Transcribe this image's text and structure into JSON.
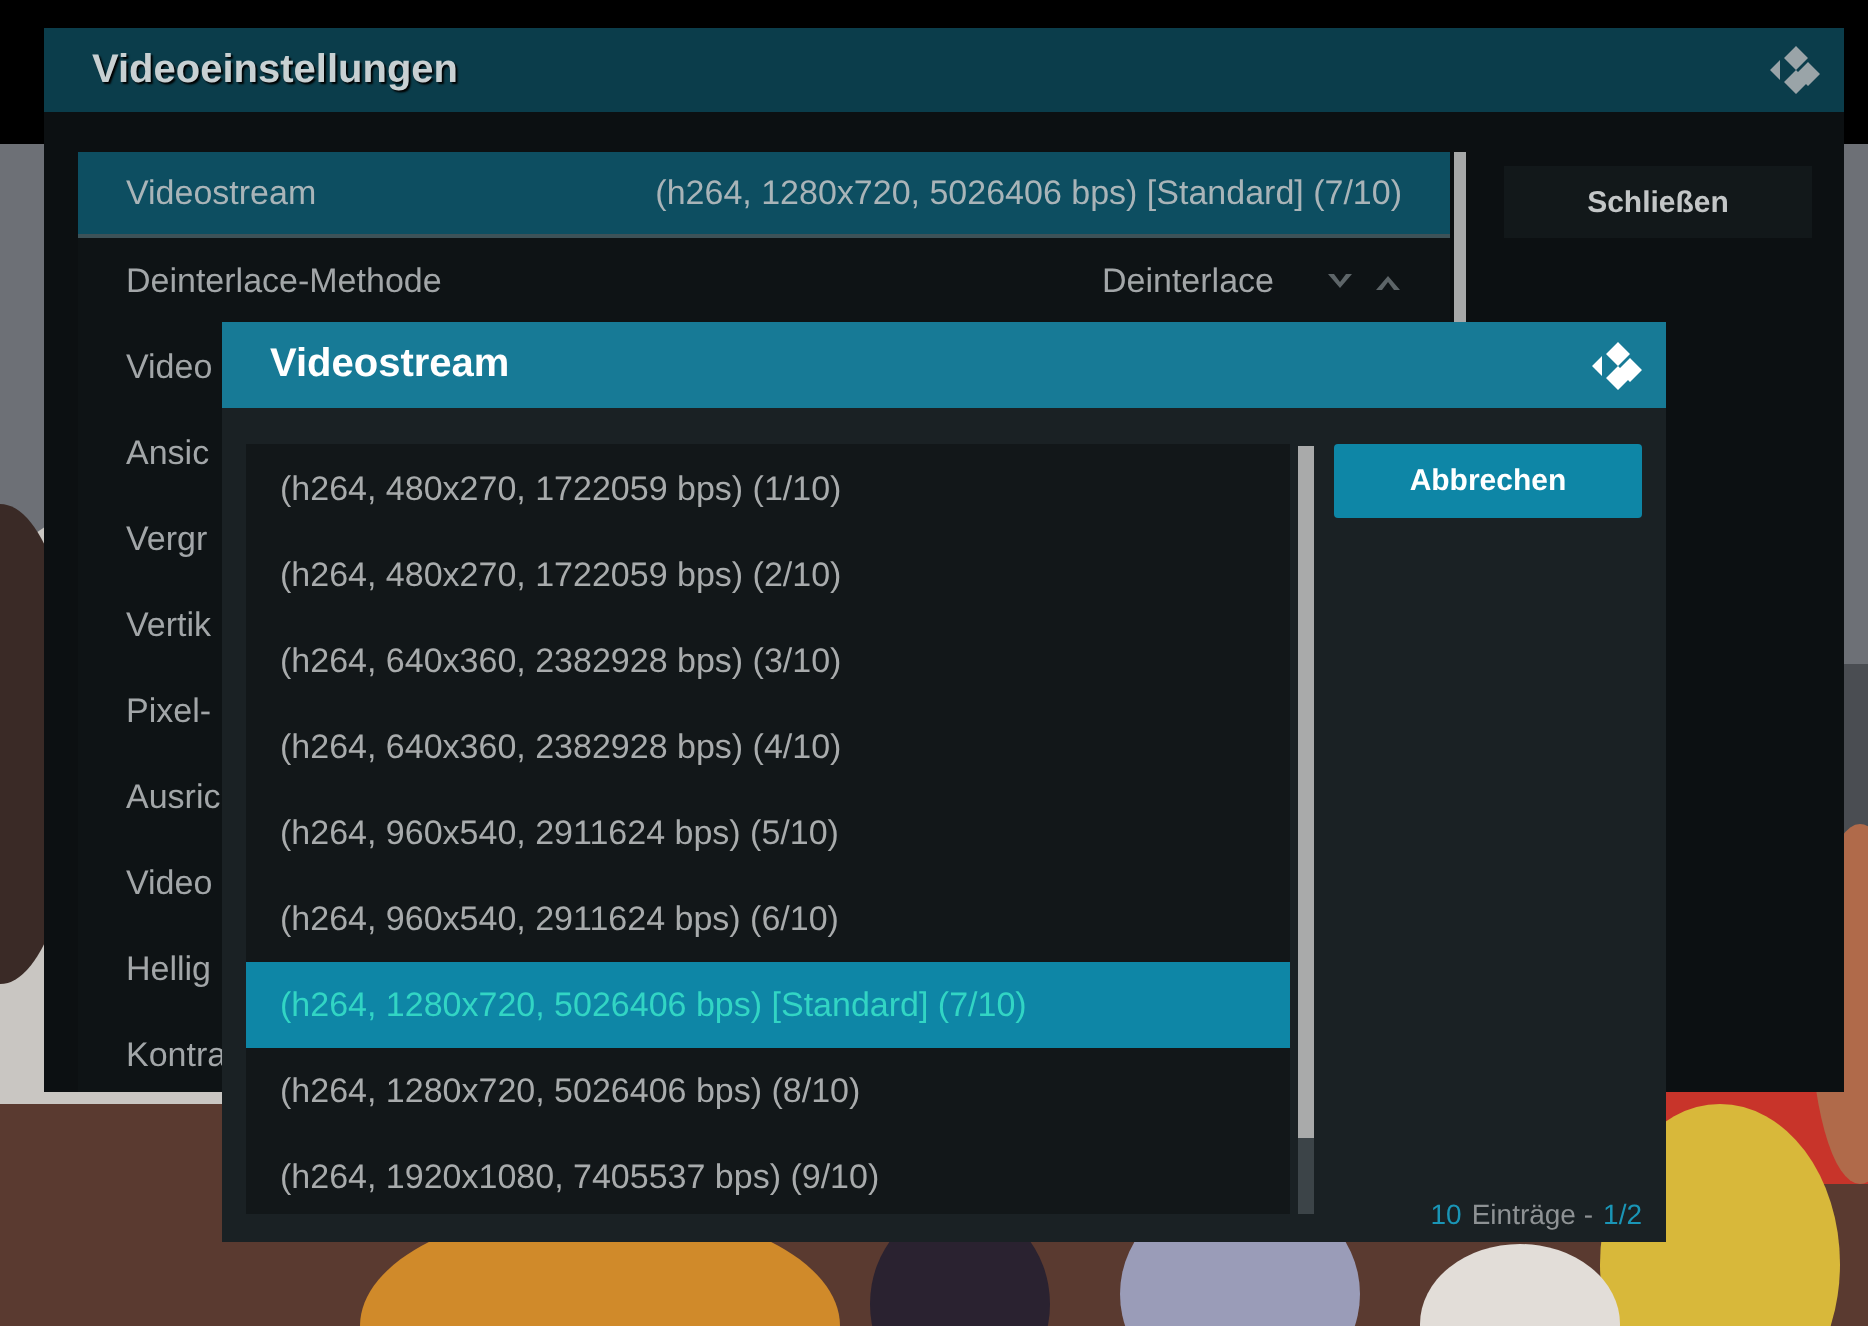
{
  "settings_dialog": {
    "title": "Videoeinstellungen",
    "items": [
      {
        "label": "Videostream",
        "value": "(h264, 1280x720, 5026406 bps) [Standard] (7/10)",
        "kind": "text",
        "selected": true
      },
      {
        "label": "Deinterlace-Methode",
        "value": "Deinterlace",
        "kind": "spinner",
        "selected": false
      },
      {
        "label": "Video",
        "kind": "text",
        "selected": false
      },
      {
        "label": "Ansic",
        "kind": "text",
        "selected": false
      },
      {
        "label": "Vergr",
        "kind": "text",
        "selected": false
      },
      {
        "label": "Vertik",
        "kind": "text",
        "selected": false
      },
      {
        "label": "Pixel-",
        "kind": "text",
        "selected": false
      },
      {
        "label": "Ausric",
        "kind": "text",
        "selected": false
      },
      {
        "label": "Video",
        "kind": "text",
        "selected": false
      },
      {
        "label": "Hellig",
        "kind": "text",
        "selected": false
      },
      {
        "label": "Kontra",
        "kind": "text",
        "selected": false
      }
    ],
    "close_button": "Schließen"
  },
  "stream_dialog": {
    "title": "Videostream",
    "items": [
      {
        "label": "(h264, 480x270, 1722059 bps) (1/10)",
        "selected": false
      },
      {
        "label": "(h264, 480x270, 1722059 bps) (2/10)",
        "selected": false
      },
      {
        "label": "(h264, 640x360, 2382928 bps) (3/10)",
        "selected": false
      },
      {
        "label": "(h264, 640x360, 2382928 bps) (4/10)",
        "selected": false
      },
      {
        "label": "(h264, 960x540, 2911624 bps) (5/10)",
        "selected": false
      },
      {
        "label": "(h264, 960x540, 2911624 bps) (6/10)",
        "selected": false
      },
      {
        "label": "(h264, 1280x720, 5026406 bps) [Standard] (7/10)",
        "selected": true
      },
      {
        "label": "(h264, 1280x720, 5026406 bps) (8/10)",
        "selected": false
      },
      {
        "label": "(h264, 1920x1080, 7405537 bps) (9/10)",
        "selected": false
      }
    ],
    "cancel_button": "Abbrechen",
    "footer": {
      "count": "10",
      "label": "Einträge -",
      "page": "1/2"
    }
  }
}
